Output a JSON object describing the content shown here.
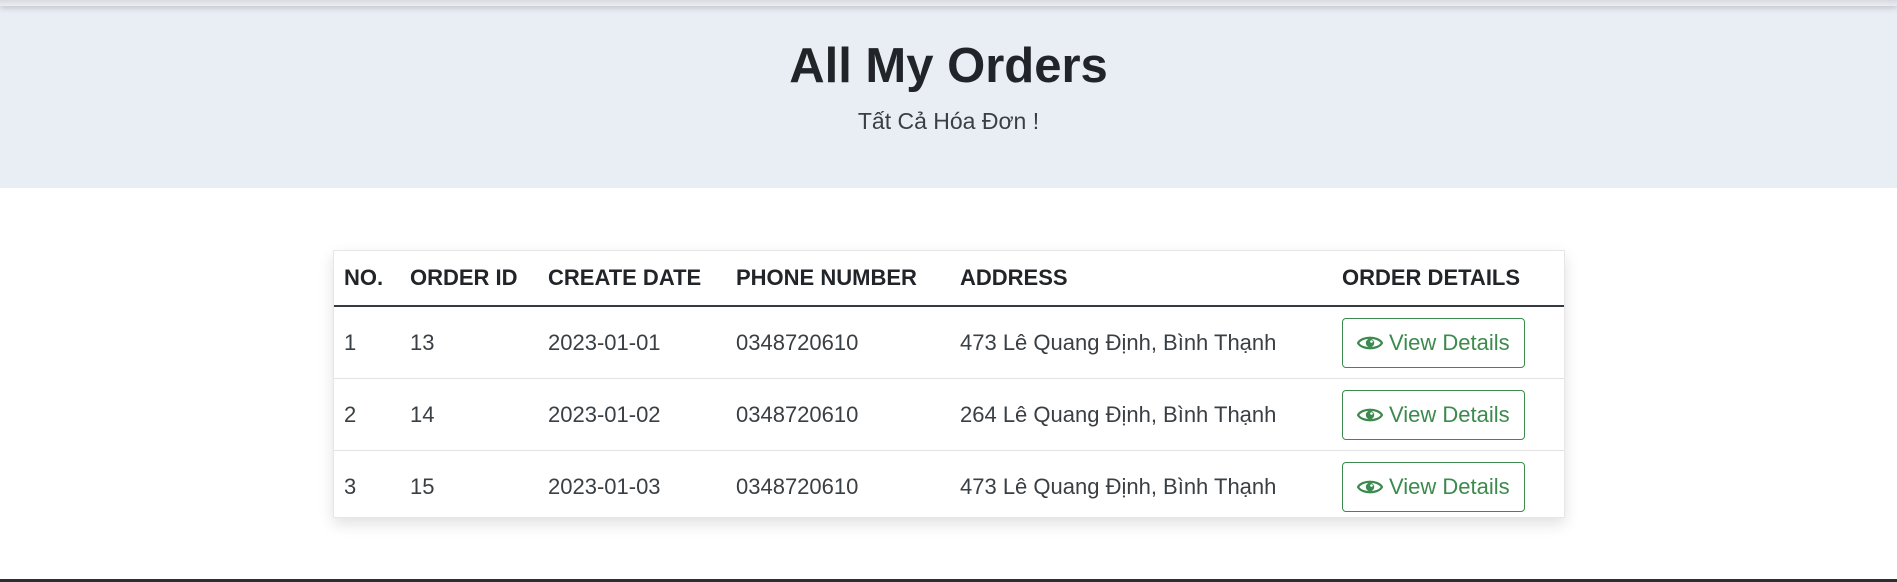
{
  "hero": {
    "title": "All My Orders",
    "subtitle": "Tất Cả Hóa Đơn !"
  },
  "table": {
    "headers": [
      "NO.",
      "ORDER ID",
      "CREATE DATE",
      "PHONE NUMBER",
      "ADDRESS",
      "ORDER DETAILS"
    ],
    "rows": [
      {
        "no": "1",
        "order_id": "13",
        "create_date": "2023-01-01",
        "phone": "0348720610",
        "address": "473 Lê Quang Định, Bình Thạnh",
        "action": "View Details"
      },
      {
        "no": "2",
        "order_id": "14",
        "create_date": "2023-01-02",
        "phone": "0348720610",
        "address": "264 Lê Quang Định, Bình Thạnh",
        "action": "View Details"
      },
      {
        "no": "3",
        "order_id": "15",
        "create_date": "2023-01-03",
        "phone": "0348720610",
        "address": "473 Lê Quang Định, Bình Thạnh",
        "action": "View Details"
      }
    ]
  },
  "colors": {
    "hero_bg": "#e9edf4",
    "accent_green": "#3c8a4e",
    "text_dark": "#212529"
  },
  "icons": {
    "view": "eye-icon"
  }
}
